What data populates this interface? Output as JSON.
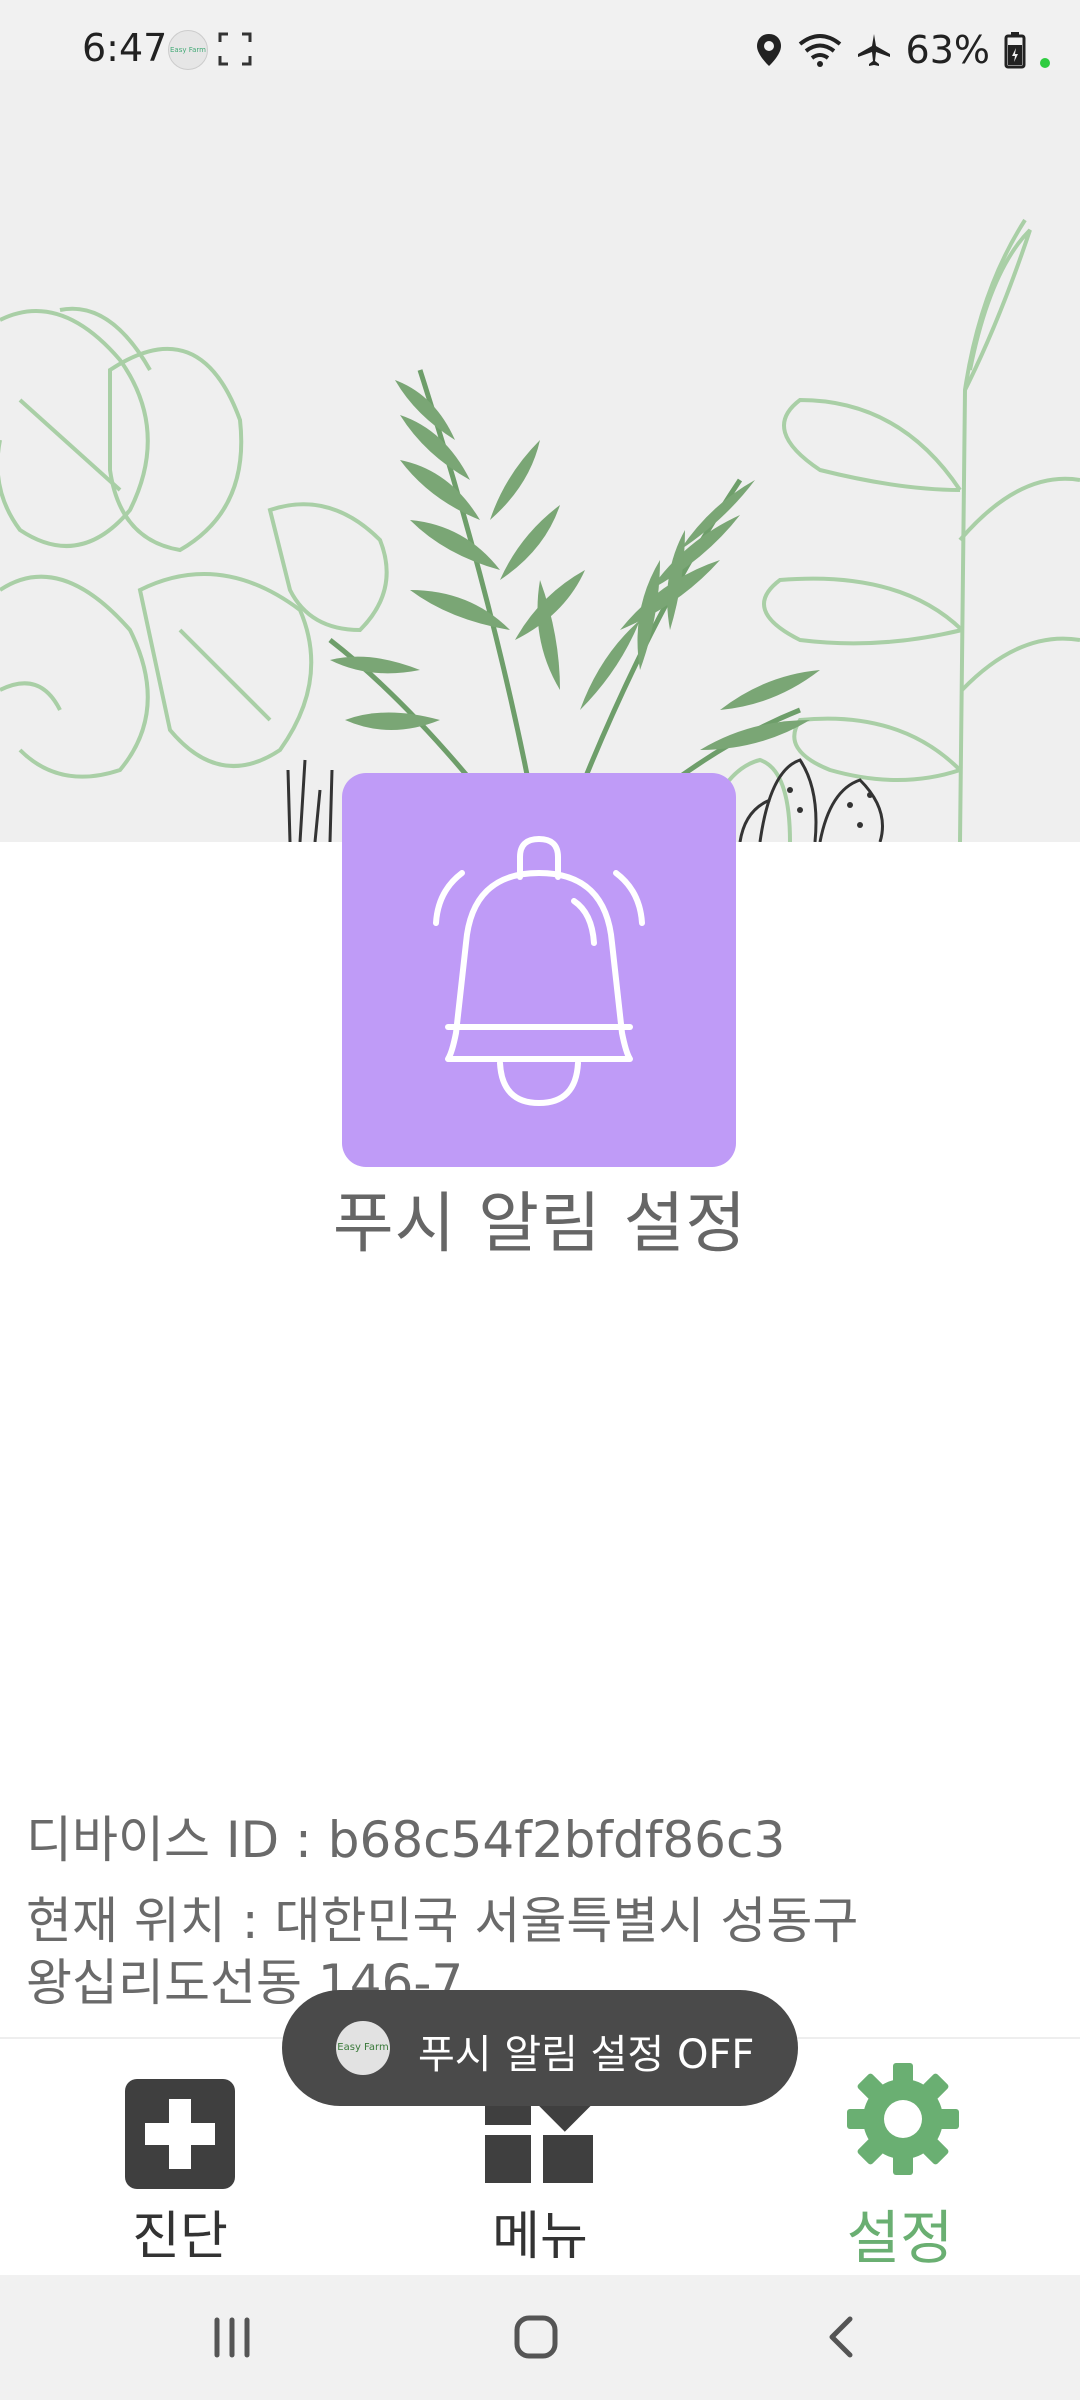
{
  "status_bar": {
    "time": "6:47",
    "app_icon_text": "Easy Farm",
    "battery": "63%"
  },
  "main": {
    "push_title": "푸시 알림 설정",
    "device_id": "디바이스 ID : b68c54f2bfdf86c3",
    "location": "현재 위치 : 대한민국 서울특별시 성동구 왕십리도선동 146-7"
  },
  "toast": {
    "icon_text": "Easy Farm",
    "message": "푸시 알림 설정 OFF"
  },
  "bottom_nav": {
    "items": [
      {
        "label": "진단",
        "icon": "plus-icon"
      },
      {
        "label": "메뉴",
        "icon": "menu-blocks-icon"
      },
      {
        "label": "설정",
        "icon": "gear-icon"
      }
    ],
    "active": "설정"
  },
  "colors": {
    "accent_green": "#6aaf72",
    "bell_card": "#bf9bf7",
    "toast_bg": "#4a4a4a"
  },
  "icons": [
    "location-icon",
    "wifi-icon",
    "airplane-icon",
    "battery-icon",
    "bell-icon",
    "home-icon",
    "recents-icon",
    "back-icon"
  ]
}
